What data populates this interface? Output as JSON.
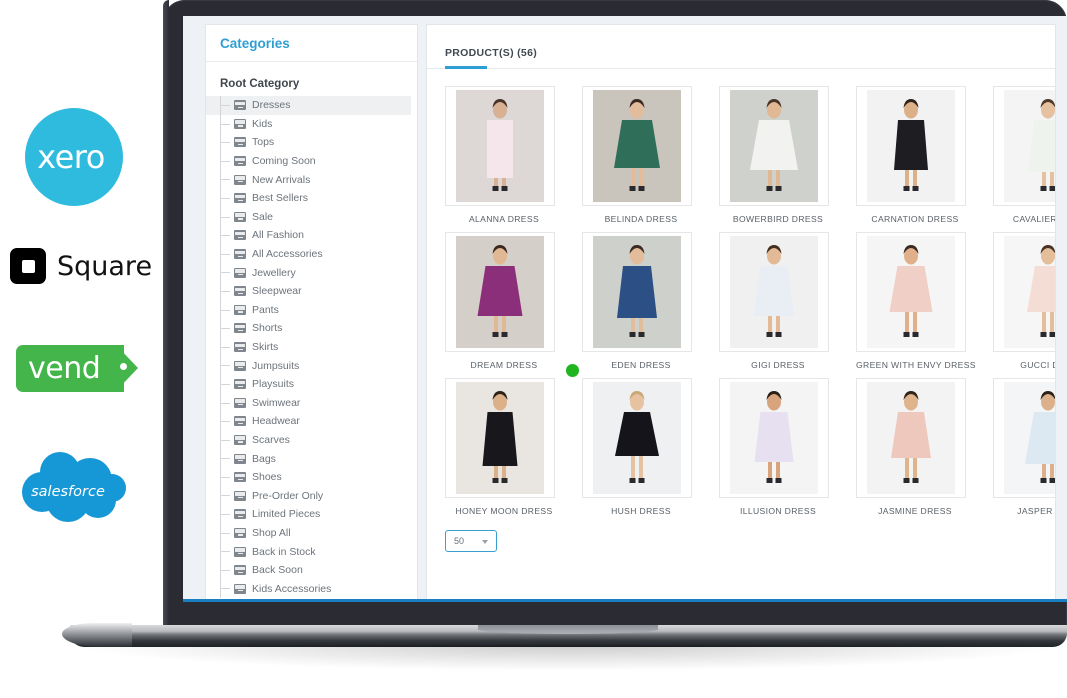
{
  "brand_logos": [
    {
      "name": "xero",
      "text": "xero",
      "color": "#2EBBDE"
    },
    {
      "name": "square",
      "text": "Square",
      "color": "#000000"
    },
    {
      "name": "vend",
      "text": "vend",
      "color": "#43B54A"
    },
    {
      "name": "salesforce",
      "text": "salesforce",
      "color": "#1798D6"
    }
  ],
  "app": {
    "sidebar": {
      "title": "Categories",
      "root_label": "Root Category",
      "selected": "Dresses",
      "items": [
        {
          "label": "Dresses"
        },
        {
          "label": "Kids"
        },
        {
          "label": "Tops"
        },
        {
          "label": "Coming Soon"
        },
        {
          "label": "New Arrivals"
        },
        {
          "label": "Best Sellers"
        },
        {
          "label": "Sale"
        },
        {
          "label": "All Fashion"
        },
        {
          "label": "All Accessories"
        },
        {
          "label": "Jewellery"
        },
        {
          "label": "Sleepwear"
        },
        {
          "label": "Pants"
        },
        {
          "label": "Shorts"
        },
        {
          "label": "Skirts"
        },
        {
          "label": "Jumpsuits"
        },
        {
          "label": "Playsuits"
        },
        {
          "label": "Swimwear"
        },
        {
          "label": "Headwear"
        },
        {
          "label": "Scarves"
        },
        {
          "label": "Bags"
        },
        {
          "label": "Shoes"
        },
        {
          "label": "Pre-Order Only"
        },
        {
          "label": "Limited Pieces"
        },
        {
          "label": "Shop All"
        },
        {
          "label": "Back in Stock"
        },
        {
          "label": "Back Soon"
        },
        {
          "label": "Kids Accessories"
        }
      ]
    },
    "main": {
      "tab_label": "PRODUCT(S) (56)",
      "accent_color": "#2e9fd4",
      "rows": [
        [
          {
            "label": "ALANNA DRESS"
          },
          {
            "label": "BELINDA DRESS"
          },
          {
            "label": "BOWERBIRD DRESS"
          },
          {
            "label": "CARNATION DRESS"
          },
          {
            "label": "CAVALIER DRESS"
          }
        ],
        [
          {
            "label": "DREAM DRESS"
          },
          {
            "label": "EDEN DRESS"
          },
          {
            "label": "GIGI DRESS"
          },
          {
            "label": "GREEN WITH ENVY DRESS"
          },
          {
            "label": "GUCCI DRESS"
          }
        ],
        [
          {
            "label": "HONEY MOON DRESS"
          },
          {
            "label": "HUSH DRESS"
          },
          {
            "label": "ILLUSION DRESS"
          },
          {
            "label": "JASMINE DRESS"
          },
          {
            "label": "JASPER DRESS"
          }
        ]
      ],
      "cursor_on": "HUSH DRESS",
      "cursor_color": "#22b522",
      "page_size": "50"
    }
  }
}
